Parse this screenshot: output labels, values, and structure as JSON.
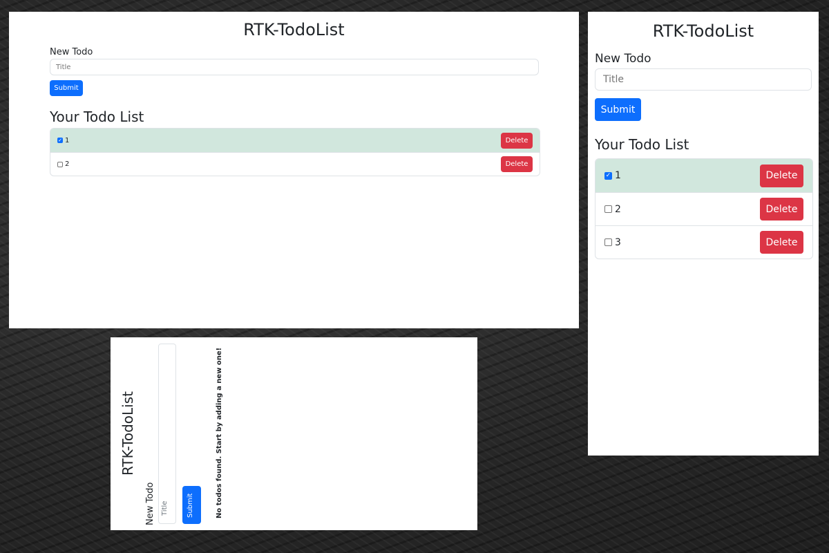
{
  "colors": {
    "primary": "#0d6efd",
    "danger": "#dc3545",
    "completed_row": "#d1e7dd",
    "border": "#dee2e6"
  },
  "panels": {
    "desktop": {
      "title": "RTK-TodoList",
      "form": {
        "label": "New Todo",
        "placeholder": "Title",
        "submit": "Submit"
      },
      "list_title": "Your Todo List",
      "todos": [
        {
          "label": "1",
          "done": true,
          "delete": "Delete"
        },
        {
          "label": "2",
          "done": false,
          "delete": "Delete"
        }
      ]
    },
    "mobile": {
      "title": "RTK-TodoList",
      "form": {
        "label": "New Todo",
        "placeholder": "Title",
        "submit": "Submit"
      },
      "list_title": "Your Todo List",
      "todos": [
        {
          "label": "1",
          "done": true,
          "delete": "Delete"
        },
        {
          "label": "2",
          "done": false,
          "delete": "Delete"
        },
        {
          "label": "3",
          "done": false,
          "delete": "Delete"
        }
      ]
    },
    "empty": {
      "title": "RTK-TodoList",
      "form": {
        "label": "New Todo",
        "placeholder": "Title",
        "submit": "Submit"
      },
      "empty_message": "No todos found. Start by adding a new one!"
    }
  }
}
